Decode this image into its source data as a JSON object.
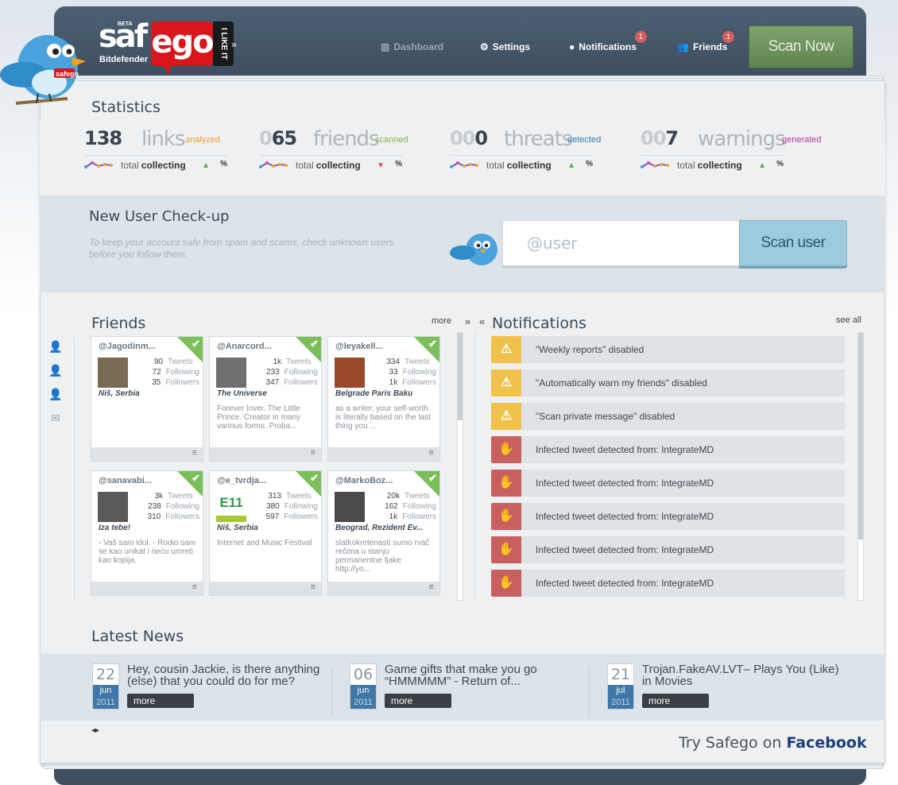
{
  "brand": {
    "beta": "BETA",
    "saf": "saf",
    "ego": "ego",
    "likeit": "I LIKE IT",
    "bitdefender": "Bitdefender"
  },
  "nav": {
    "dashboard": "Dashboard",
    "settings": "Settings",
    "notifications": "Notifications",
    "notifications_badge": "1",
    "friends": "Friends",
    "friends_badge": "1",
    "scan_now": "Scan Now"
  },
  "statistics": {
    "title": "Statistics",
    "items": [
      {
        "num_dim": "",
        "num": "138",
        "word": "links",
        "sub": "analyzed",
        "sub_color": "#f0a030",
        "total": "total",
        "collecting": "collecting",
        "trend": "up",
        "pct": "%"
      },
      {
        "num_dim": "0",
        "num": "65",
        "word": "friends",
        "sub": "scanned",
        "sub_color": "#8ab34a",
        "total": "total",
        "collecting": "collecting",
        "trend": "down",
        "pct": "%"
      },
      {
        "num_dim": "00",
        "num": "0",
        "word": "threats",
        "sub": "detected",
        "sub_color": "#2e7db5",
        "total": "total",
        "collecting": "collecting",
        "trend": "up",
        "pct": "%"
      },
      {
        "num_dim": "00",
        "num": "7",
        "word": "warnings",
        "sub": "generated",
        "sub_color": "#b33aa0",
        "total": "total",
        "collecting": "collecting",
        "trend": "up",
        "pct": "%"
      }
    ]
  },
  "checkup": {
    "title": "New User Check-up",
    "description": "To keep your account safe from spam and scams, check unknown users before you follow them.",
    "placeholder": "@user",
    "button": "Scan user"
  },
  "friends": {
    "title": "Friends",
    "more": "more",
    "cards": [
      {
        "handle": "@Jagodinm...",
        "tweets": "90",
        "following": "72",
        "followers": "35",
        "location": "Niš, Serbia",
        "bio": ""
      },
      {
        "handle": "@Anarcord...",
        "tweets": "1k",
        "following": "233",
        "followers": "347",
        "location": "The Universe",
        "bio": "Forever lover. The Little Prince. Creator in many various forms. Proba..."
      },
      {
        "handle": "@leyakell...",
        "tweets": "334",
        "following": "33",
        "followers": "1k",
        "location": "Belgrade Paris Baku",
        "bio": "as a writer, your self-worth is literally based on the last thing you ..."
      },
      {
        "handle": "@sanavabi...",
        "tweets": "3k",
        "following": "238",
        "followers": "310",
        "location": "Iza tebe!",
        "bio": "- Vaš sam idol. - Rodio sam se kao unikat i neću umreti kao kopija."
      },
      {
        "handle": "@e_tvrdja...",
        "tweets": "313",
        "following": "380",
        "followers": "597",
        "location": "Niš, Serbia",
        "bio": "Internet and Music Festival",
        "avatar_text": "E11"
      },
      {
        "handle": "@MarkoBoz...",
        "tweets": "20k",
        "following": "162",
        "followers": "1k",
        "location": "Beograd, Rezident Ev...",
        "bio": "slatkokretenasti sumo rvač rečima u stanju permanentne fjake http://yo..."
      }
    ],
    "labels": {
      "tweets": "Tweets",
      "following": "Following",
      "followers": "Followers"
    }
  },
  "notifications": {
    "title": "Notifications",
    "see_all": "see all",
    "items": [
      {
        "type": "warn",
        "text": "\"Weekly reports\" disabled"
      },
      {
        "type": "warn",
        "text": "\"Automatically warn my friends\" disabled"
      },
      {
        "type": "warn",
        "text": "\"Scan private message\" disabled"
      },
      {
        "type": "bad",
        "text": "Infected tweet detected from: IntegrateMD"
      },
      {
        "type": "bad",
        "text": "Infected tweet detected from: IntegrateMD"
      },
      {
        "type": "bad",
        "text": "Infected tweet detected from: IntegrateMD"
      },
      {
        "type": "bad",
        "text": "Infected tweet detected from: IntegrateMD"
      },
      {
        "type": "bad",
        "text": "Infected tweet detected from: IntegrateMD"
      }
    ]
  },
  "news": {
    "title": "Latest News",
    "items": [
      {
        "day": "22",
        "month": "jun",
        "year": "2011",
        "title": "Hey, cousin Jackie, is there anything (else) that you could do for me?",
        "more": "more"
      },
      {
        "day": "06",
        "month": "jun",
        "year": "2011",
        "title": "Game gifts that make you go “HMMMMM” - Return of...",
        "more": "more"
      },
      {
        "day": "21",
        "month": "jul",
        "year": "2011",
        "title": "Trojan.FakeAV.LVT– Plays You (Like) in Movies",
        "more": "more"
      }
    ]
  },
  "footer": {
    "try": "Try Safego on",
    "facebook": "Facebook",
    "arrows": "◂▸"
  }
}
